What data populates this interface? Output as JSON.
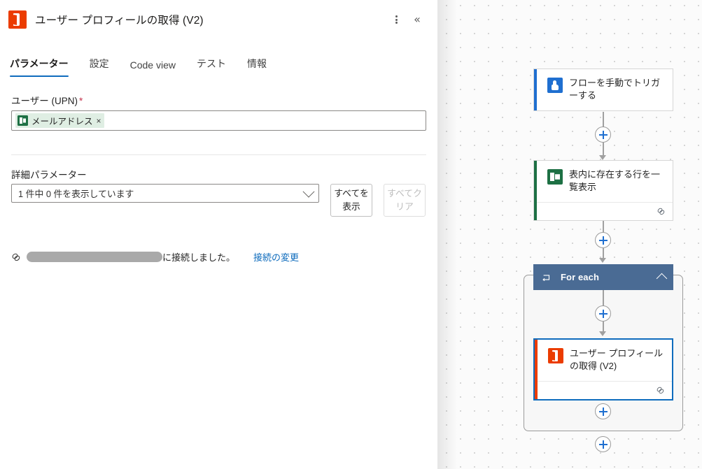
{
  "panel": {
    "app_icon": "office365-icon",
    "title": "ユーザー プロフィールの取得 (V2)",
    "more_menu": "kebab-menu-icon",
    "collapse": "«",
    "tabs": [
      {
        "label": "パラメーター",
        "active": true
      },
      {
        "label": "設定",
        "active": false
      },
      {
        "label": "Code view",
        "active": false
      },
      {
        "label": "テスト",
        "active": false
      },
      {
        "label": "情報",
        "active": false
      }
    ],
    "user_field": {
      "label": "ユーザー (UPN)",
      "required_marker": "*",
      "token": {
        "icon": "excel-icon",
        "text": "メールアドレス",
        "remove": "×"
      }
    },
    "advanced": {
      "label": "詳細パラメーター",
      "select_value": "1 件中 0 件を表示しています",
      "chevron": "chevron-down-icon",
      "show_all_button": "すべてを表示",
      "clear_all_button": "すべてクリア"
    },
    "connection": {
      "icon": "link-icon",
      "name_redacted": "",
      "status_text": "に接続しました。",
      "change_link": "接続の変更"
    },
    "colors": {
      "accent_blue": "#0f6cbd",
      "required_red": "#c4314b",
      "office_orange": "#eb3c00",
      "excel_green": "#1d7044",
      "token_bg": "#dfeee3"
    }
  },
  "canvas": {
    "nodes": [
      {
        "id": "manual-trigger",
        "title": "フローを手動でトリガーする",
        "icon": "manual-trigger-icon",
        "accent_color": "#1f6fd0",
        "has_footer": false,
        "selected": false
      },
      {
        "id": "list-rows",
        "title": "表内に存在する行を一覧表示",
        "icon": "excel-icon",
        "accent_color": "#1d7044",
        "has_footer": true,
        "footer_icon": "link-icon",
        "selected": false
      },
      {
        "id": "get-user-profile",
        "title": "ユーザー プロフィールの取得 (V2)",
        "icon": "office365-icon",
        "accent_color": "#eb3c00",
        "has_footer": true,
        "footer_icon": "link-icon",
        "selected": true
      }
    ],
    "foreach": {
      "title": "For each",
      "icon": "loop-icon",
      "collapse_chevron": "chevron-up-icon",
      "header_color": "#4a6b94"
    },
    "add_buttons": [
      {
        "id": "add-after-trigger"
      },
      {
        "id": "add-after-list-rows"
      },
      {
        "id": "add-inside-foreach-top"
      },
      {
        "id": "add-inside-foreach-bottom"
      },
      {
        "id": "add-after-foreach"
      }
    ]
  }
}
